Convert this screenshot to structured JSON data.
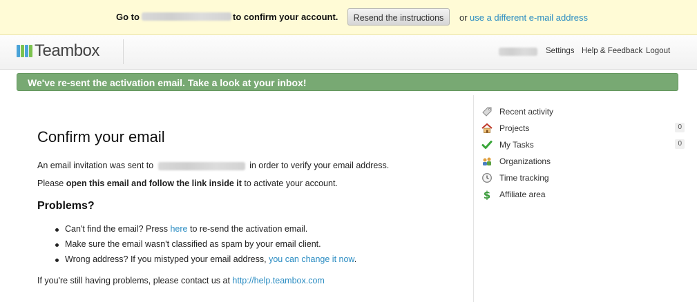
{
  "confirm_bar": {
    "goto_text": "Go to",
    "confirm_text": "to confirm your account.",
    "resend_label": "Resend the instructions",
    "or_text": "or",
    "different_email_link": "use a different e-mail address"
  },
  "header": {
    "logo_text": "Teambox",
    "nav": {
      "settings": "Settings",
      "help": "Help & Feedback",
      "logout": "Logout"
    }
  },
  "flash": {
    "message": "We've re-sent the activation email. Take a look at your inbox!"
  },
  "main": {
    "title": "Confirm your email",
    "p1_prefix": "An email invitation was sent to",
    "p1_suffix": "in order to verify your email address.",
    "p2_prefix": "Please",
    "p2_bold": "open this email and follow the link inside it",
    "p2_suffix": "to activate your account.",
    "problems_heading": "Problems?",
    "problems": {
      "item1_prefix": "Can't find the email? Press",
      "item1_link": "here",
      "item1_suffix": "to re-send the activation email.",
      "item2": "Make sure the email wasn't classified as spam by your email client.",
      "item3_prefix": "Wrong address? If you mistyped your email address,",
      "item3_link": "you can change it now",
      "item3_suffix": "."
    },
    "contact_prefix": "If you're still having problems, please contact us at",
    "contact_link": "http://help.teambox.com"
  },
  "sidebar": {
    "items": [
      {
        "label": "Recent activity",
        "icon": "tag-icon"
      },
      {
        "label": "Projects",
        "icon": "house-icon",
        "count": "0"
      },
      {
        "label": "My Tasks",
        "icon": "checkmark-icon",
        "count": "0"
      },
      {
        "label": "Organizations",
        "icon": "organizations-icon"
      },
      {
        "label": "Time tracking",
        "icon": "clock-icon"
      },
      {
        "label": "Affiliate area",
        "icon": "dollar-icon"
      }
    ]
  },
  "colors": {
    "confirm_bar_bg": "#fffbd6",
    "flash_bg": "#78a973",
    "link": "#2a8cc2"
  }
}
